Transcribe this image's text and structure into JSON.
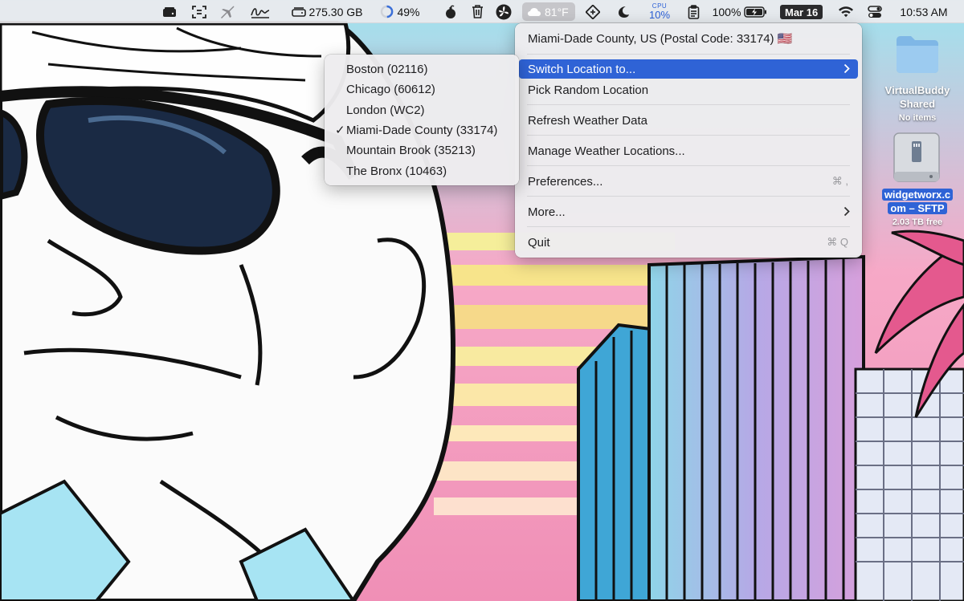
{
  "menubar": {
    "disk_free": "275.30 GB",
    "memory_percent": "49%",
    "weather_temp": "81°F",
    "cpu_label": "CPU",
    "cpu_value": "10%",
    "battery_percent": "100%",
    "date": "Mar 16",
    "time": "10:53 AM",
    "icons": [
      "drive-icon",
      "screenshot-icon",
      "airplane-icon",
      "signature-icon",
      "disk-icon",
      "memory-ring-icon",
      "bomb-icon",
      "trash-icon",
      "fan-icon",
      "cloud-icon",
      "ruler-icon",
      "moon-icon",
      "clipboard-icon",
      "battery-icon",
      "wifi-icon",
      "control-center-icon"
    ]
  },
  "weather_menu": {
    "header": "Miami-Dade County, US (Postal Code: 33174) 🇺🇸",
    "items": [
      {
        "label": "Switch Location to...",
        "has_submenu": true,
        "highlighted": true
      },
      {
        "label": "Pick Random Location"
      },
      {
        "label": "Refresh Weather Data"
      },
      {
        "label": "Manage Weather Locations..."
      },
      {
        "label": "Preferences...",
        "shortcut": "⌘ ,"
      },
      {
        "label": "More...",
        "has_submenu": true
      },
      {
        "label": "Quit",
        "shortcut": "⌘ Q"
      }
    ]
  },
  "location_submenu": {
    "items": [
      {
        "label": "Boston (02116)",
        "checked": false
      },
      {
        "label": "Chicago (60612)",
        "checked": false
      },
      {
        "label": "London (WC2)",
        "checked": false
      },
      {
        "label": "Miami-Dade County (33174)",
        "checked": true
      },
      {
        "label": "Mountain Brook (35213)",
        "checked": false
      },
      {
        "label": "The Bronx (10463)",
        "checked": false
      }
    ],
    "check_glyph": "✓"
  },
  "desktop": {
    "folder": {
      "name": "VirtualBuddy Shared",
      "name_line1": "VirtualBuddy",
      "name_line2": "Shared",
      "subtitle": "No items"
    },
    "drive": {
      "name": "widgetworx.com – SFTP",
      "name_line1": "widgetworx.c",
      "name_line2": "om – SFTP",
      "subtitle": "2.03 TB free"
    }
  }
}
